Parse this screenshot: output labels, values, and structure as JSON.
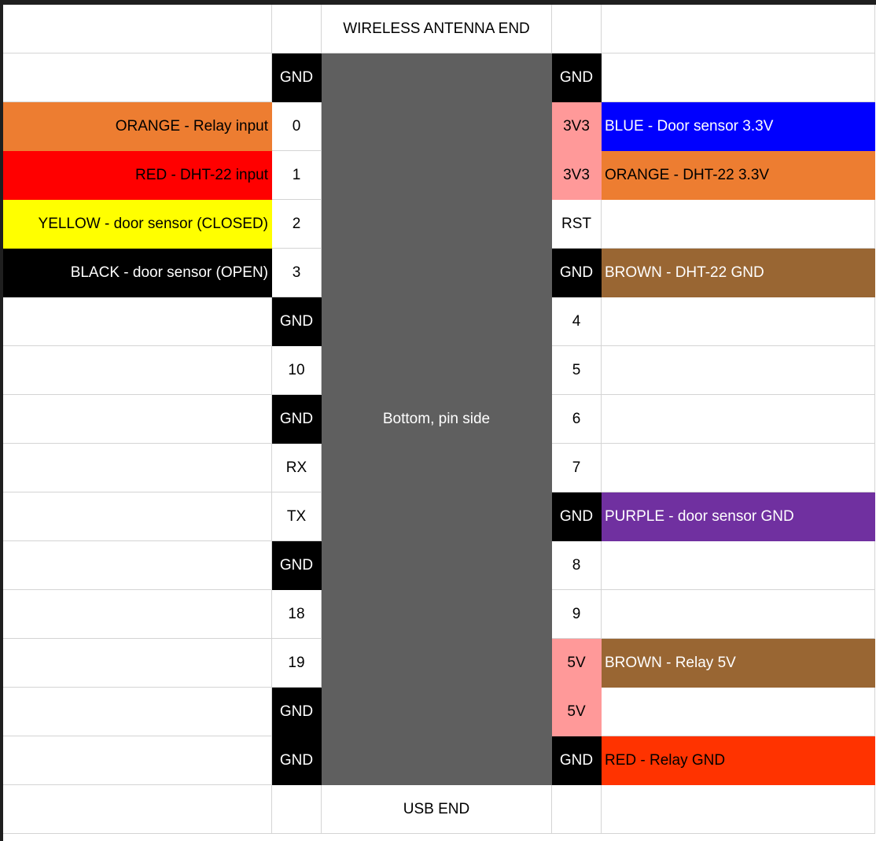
{
  "palette": {
    "black": "#000000",
    "white": "#ffffff",
    "orange": "#ed7d31",
    "red": "#ff0000",
    "yellow": "#ffff00",
    "blue": "#0000ff",
    "brown": "#996633",
    "purple": "#7030a0",
    "red_orange": "#ff3300",
    "pink": "#ff9999",
    "chip_gray": "#5f5f5f"
  },
  "board": {
    "top_label": "WIRELESS ANTENNA END",
    "bottom_label": "USB END",
    "center_label": "Bottom, pin side"
  },
  "rows": [
    {
      "left_pin": "GND",
      "left_pin_bg": "black",
      "right_pin": "GND",
      "right_pin_bg": "black"
    },
    {
      "left_wire": "ORANGE - Relay input",
      "left_wire_bg": "orange",
      "left_pin": "0",
      "right_pin": "3V3",
      "right_pin_bg": "pink",
      "right_wire": "BLUE - Door sensor 3.3V",
      "right_wire_bg": "blue"
    },
    {
      "left_wire": "RED - DHT-22 input",
      "left_wire_bg": "red",
      "left_pin": "1",
      "right_pin": "3V3",
      "right_pin_bg": "pink",
      "right_wire": "ORANGE - DHT-22 3.3V",
      "right_wire_bg": "orange"
    },
    {
      "left_wire": "YELLOW - door sensor (CLOSED)",
      "left_wire_bg": "yellow",
      "left_pin": "2",
      "right_pin": "RST"
    },
    {
      "left_wire": "BLACK - door sensor (OPEN)",
      "left_wire_bg": "black",
      "left_pin": "3",
      "right_pin": "GND",
      "right_pin_bg": "black",
      "right_wire": "BROWN - DHT-22 GND",
      "right_wire_bg": "brown"
    },
    {
      "left_pin": "GND",
      "left_pin_bg": "black",
      "right_pin": "4"
    },
    {
      "left_pin": "10",
      "right_pin": "5"
    },
    {
      "left_pin": "GND",
      "left_pin_bg": "black",
      "right_pin": "6"
    },
    {
      "left_pin": "RX",
      "right_pin": "7"
    },
    {
      "left_pin": "TX",
      "right_pin": "GND",
      "right_pin_bg": "black",
      "right_wire": "PURPLE - door sensor GND",
      "right_wire_bg": "purple"
    },
    {
      "left_pin": "GND",
      "left_pin_bg": "black",
      "right_pin": "8"
    },
    {
      "left_pin": "18",
      "right_pin": "9"
    },
    {
      "left_pin": "19",
      "right_pin": "5V",
      "right_pin_bg": "pink",
      "right_wire": "BROWN - Relay 5V",
      "right_wire_bg": "brown"
    },
    {
      "left_pin": "GND",
      "left_pin_bg": "black",
      "right_pin": "5V",
      "right_pin_bg": "pink"
    },
    {
      "left_pin": "GND",
      "left_pin_bg": "black",
      "right_pin": "GND",
      "right_pin_bg": "black",
      "right_wire": "RED - Relay GND",
      "right_wire_bg": "red_orange"
    }
  ]
}
